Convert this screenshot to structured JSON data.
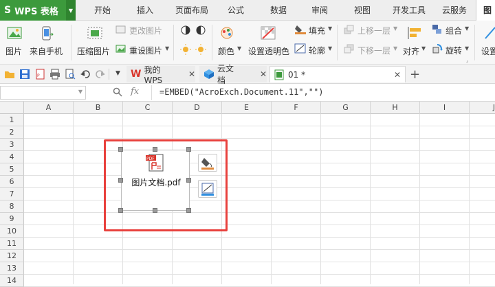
{
  "app": {
    "title": "WPS 表格"
  },
  "menu_tabs": [
    "开始",
    "插入",
    "页面布局",
    "公式",
    "数据",
    "审阅",
    "视图",
    "开发工具",
    "云服务",
    "图片"
  ],
  "ribbon": {
    "picture": "图片",
    "from_phone": "来自手机",
    "compress": "压缩图片",
    "change_pic": "更改图片",
    "reset_pic": "重设图片",
    "color": "颜色",
    "set_transparent": "设置透明色",
    "fill": "填充",
    "outline": "轮廓",
    "bring_forward": "上移一层",
    "send_backward": "下移一层",
    "align": "对齐",
    "group": "组合",
    "rotate": "旋转",
    "settings": "设置"
  },
  "doc_tabs": {
    "wps": "我的WPS",
    "cloud": "云文档",
    "file": "01 *"
  },
  "formula_bar": {
    "fx": "fx",
    "formula": "=EMBED(\"AcroExch.Document.11\",\"\")"
  },
  "columns": [
    "A",
    "B",
    "C",
    "D",
    "E",
    "F",
    "G",
    "H",
    "I",
    "J"
  ],
  "rows": [
    "1",
    "2",
    "3",
    "4",
    "5",
    "6",
    "7",
    "8",
    "9",
    "10",
    "11",
    "12",
    "13",
    "14"
  ],
  "embedded_object": {
    "label": "图片文档.pdf",
    "icon_text": "PDF"
  },
  "colors": {
    "brand_green": "#3c9a3c",
    "highlight_red": "#e8403c",
    "wps_red": "#d9352b",
    "cloud_blue": "#2f8fe0"
  }
}
